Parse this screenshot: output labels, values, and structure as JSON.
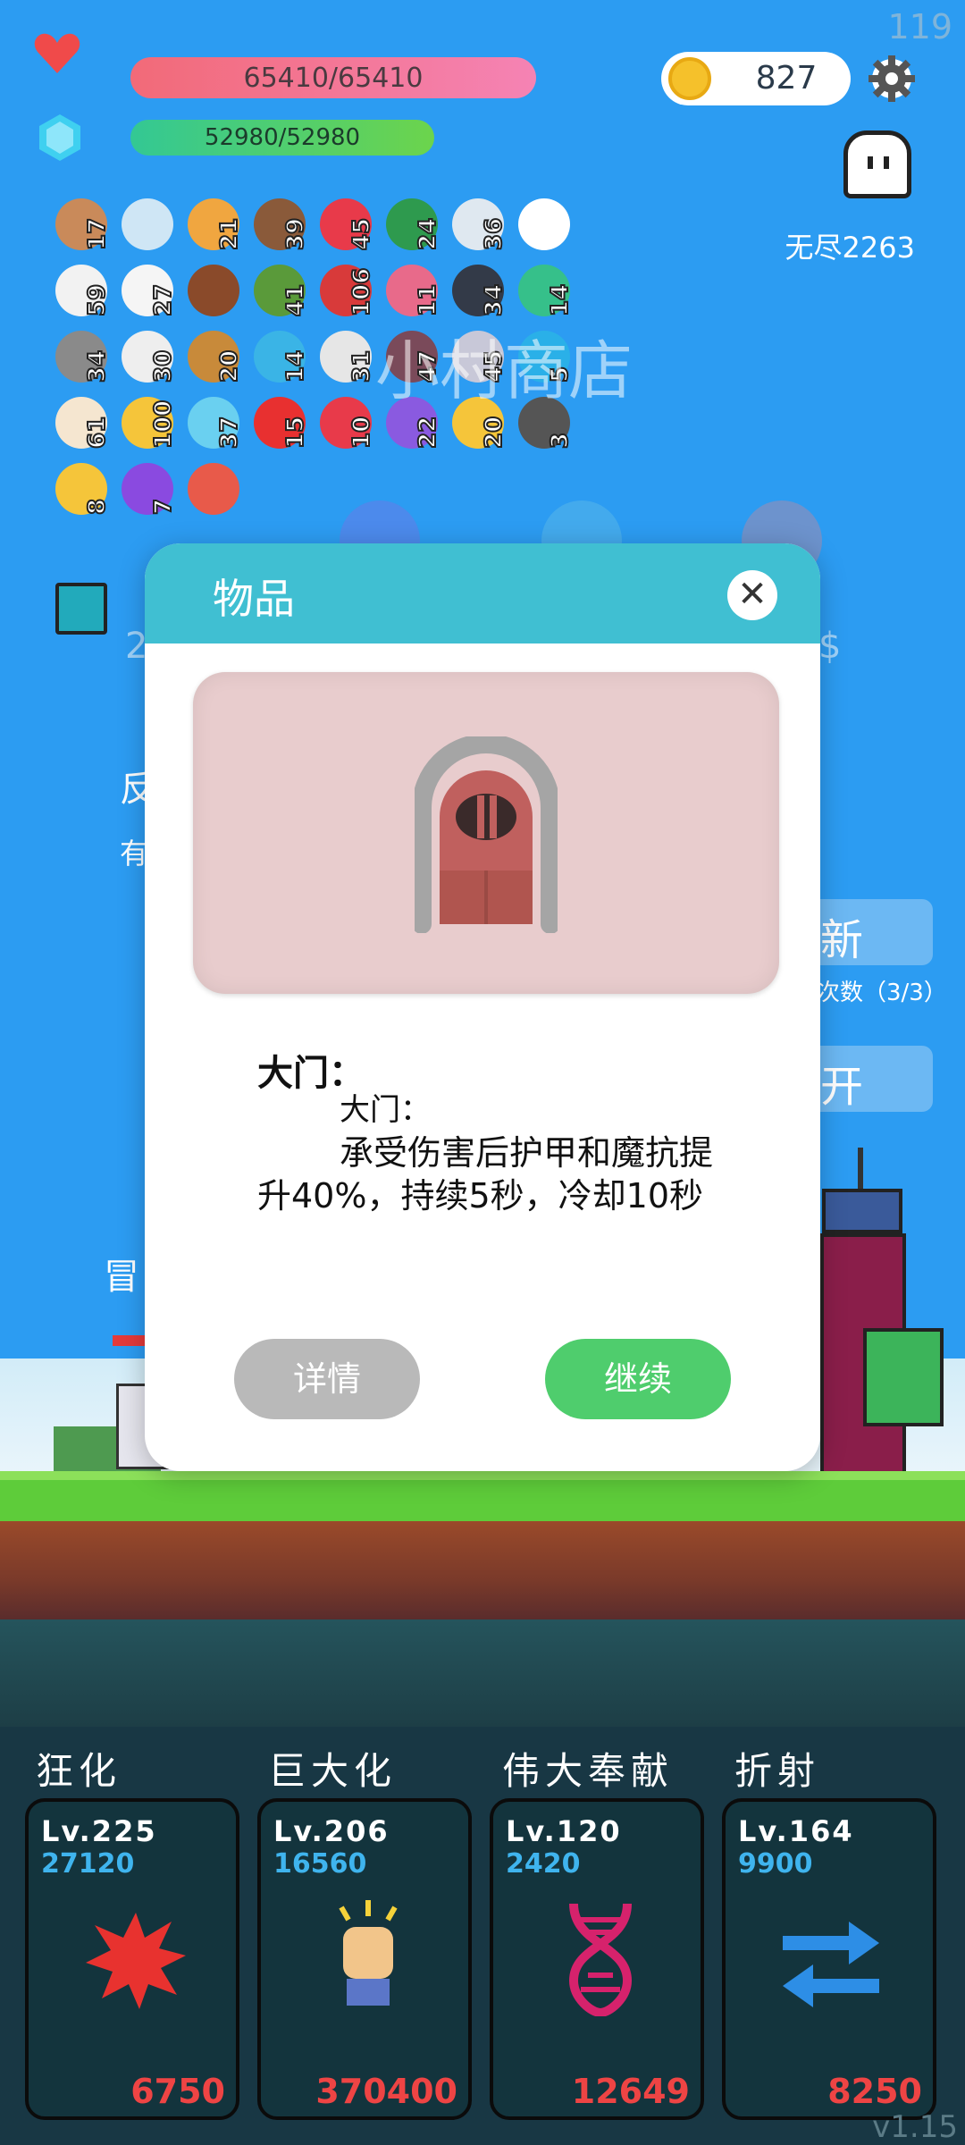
{
  "hud": {
    "fps": "119",
    "hp": "65410/65410",
    "mp": "52980/52980",
    "coins": "827",
    "endless": "无尽2263"
  },
  "items": [
    {
      "icon": "cookie-icon",
      "count": "17"
    },
    {
      "icon": "magnifier-icon",
      "count": ""
    },
    {
      "icon": "book-icon",
      "count": "21"
    },
    {
      "icon": "coconut-icon",
      "count": "39"
    },
    {
      "icon": "strawberry-icon",
      "count": "45"
    },
    {
      "icon": "watermelon-icon",
      "count": "24"
    },
    {
      "icon": "bulb-icon",
      "count": "36"
    },
    {
      "icon": "snowflake-icon",
      "count": ""
    },
    {
      "icon": "pill-icon",
      "count": "59"
    },
    {
      "icon": "ghost-icon",
      "count": "27"
    },
    {
      "icon": "chest-icon",
      "count": ""
    },
    {
      "icon": "bow-icon",
      "count": "41"
    },
    {
      "icon": "shield-icon",
      "count": "106"
    },
    {
      "icon": "jam-icon",
      "count": "11"
    },
    {
      "icon": "bomb-icon",
      "count": "34"
    },
    {
      "icon": "potion-green-icon",
      "count": "14"
    },
    {
      "icon": "mace-icon",
      "count": "34"
    },
    {
      "icon": "letter-icon",
      "count": "30"
    },
    {
      "icon": "sword-icon",
      "count": "20"
    },
    {
      "icon": "gem-icon",
      "count": "14"
    },
    {
      "icon": "dice-icon",
      "count": "31"
    },
    {
      "icon": "door-icon",
      "count": "47"
    },
    {
      "icon": "axe-icon",
      "count": "45"
    },
    {
      "icon": "shoe-icon",
      "count": "5"
    },
    {
      "icon": "cake-icon",
      "count": "61"
    },
    {
      "icon": "sunflower-icon",
      "count": "100"
    },
    {
      "icon": "orb-icon",
      "count": "37"
    },
    {
      "icon": "apple-icon",
      "count": "15"
    },
    {
      "icon": "heart-icon",
      "count": "10"
    },
    {
      "icon": "box-icon",
      "count": "22"
    },
    {
      "icon": "wand-icon",
      "count": "20"
    },
    {
      "icon": "meteor-icon",
      "count": "3"
    },
    {
      "icon": "ring-icon",
      "count": "8"
    },
    {
      "icon": "crystal-ball-icon",
      "count": "7"
    },
    {
      "icon": "flask-icon",
      "count": ""
    },
    {
      "icon": "lamp-card-icon",
      "count": ""
    }
  ],
  "background": {
    "shop_text": "小村商店",
    "text_2": "2",
    "dollar": "$",
    "fan": "反",
    "you": "有",
    "refresh_label": "新",
    "refresh_count": "次数（3/3）",
    "open_label": "开",
    "adventure": "冒"
  },
  "skills": [
    {
      "name": "狂化",
      "level": "Lv.225",
      "cost": "27120",
      "price": "6750",
      "icon": "splat-icon",
      "color": "#e8322f"
    },
    {
      "name": "巨大化",
      "level": "Lv.206",
      "cost": "16560",
      "price": "370400",
      "icon": "fist-icon",
      "color": "#f2c58a"
    },
    {
      "name": "伟大奉献",
      "level": "Lv.120",
      "cost": "2420",
      "price": "12649",
      "icon": "dna-icon",
      "color": "#d6226c"
    },
    {
      "name": "折射",
      "level": "Lv.164",
      "cost": "9900",
      "price": "8250",
      "icon": "swap-arrows-icon",
      "color": "#2d8ee6"
    }
  ],
  "version": "v1.15",
  "modal": {
    "title": "物品",
    "item_name": "大门：",
    "desc_line1": "大门：",
    "desc_line2": "承受伤害后护甲和魔抗提升40%，持续5秒，冷却10秒",
    "detail_button": "详情",
    "continue_button": "继续"
  }
}
